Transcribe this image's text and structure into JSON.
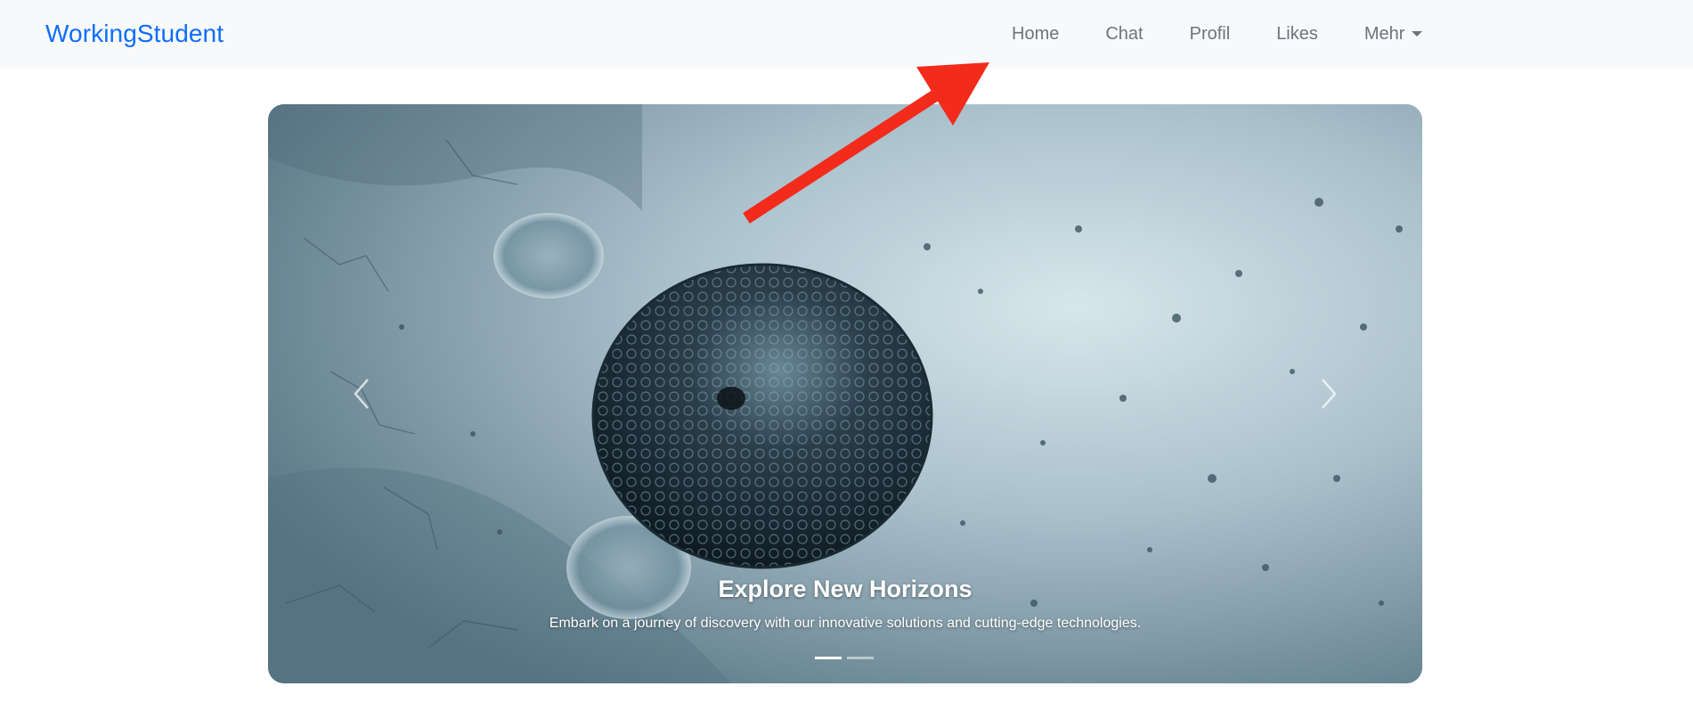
{
  "navbar": {
    "brand": "WorkingStudent",
    "links": [
      {
        "label": "Home"
      },
      {
        "label": "Chat"
      },
      {
        "label": "Profil"
      },
      {
        "label": "Likes"
      },
      {
        "label": "Mehr",
        "dropdown": true
      }
    ]
  },
  "carousel": {
    "slide_title": "Explore New Horizons",
    "slide_text": "Embark on a journey of discovery with our innovative solutions and cutting-edge technologies.",
    "indicator_count": 2,
    "active_indicator": 1,
    "prev_icon": "chevron-left-icon",
    "next_icon": "chevron-right-icon"
  },
  "colors": {
    "brand": "#0d6efd",
    "nav_text": "#6c757d",
    "navbar_bg": "#f8f9fa",
    "annotation_arrow": "#f22b1b"
  }
}
